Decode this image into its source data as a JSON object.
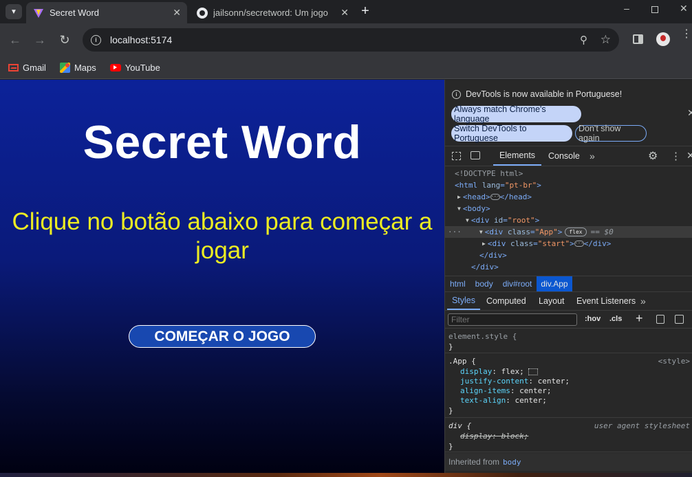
{
  "browser": {
    "tabs": [
      {
        "title": "Secret Word",
        "active": true
      },
      {
        "title": "jailsonn/secretword: Um jogo w",
        "active": false
      }
    ],
    "url": "localhost:5174",
    "bookmarks": [
      {
        "label": "Gmail",
        "icon": "gmail-icon"
      },
      {
        "label": "Maps",
        "icon": "maps-icon"
      },
      {
        "label": "YouTube",
        "icon": "youtube-icon"
      }
    ]
  },
  "app": {
    "title": "Secret Word",
    "subtitle": "Clique no botão abaixo para começar a jogar",
    "start_button": "COMEÇAR O JOGO",
    "bg_top": "#0c2299",
    "bg_bottom": "#000010",
    "subtitle_color": "#ecec22"
  },
  "devtools": {
    "notice": "DevTools is now available in Portuguese!",
    "chip_match": "Always match Chrome's language",
    "chip_switch": "Switch DevTools to Portuguese",
    "chip_dont": "Don't show again",
    "tabs": [
      "Elements",
      "Console"
    ],
    "dom": {
      "doctype": "<!DOCTYPE html>",
      "html_open": "<html",
      "html_attr": "lang",
      "html_val": "\"pt-br\"",
      "head": "<head>",
      "head_close": "</head>",
      "body": "<body>",
      "div_open": "<div",
      "id_attr": "id",
      "id_val": "\"root\"",
      "class_attr": "class",
      "app_val": "\"App\"",
      "flex_badge": "flex",
      "eq": "== $0",
      "start_val": "\"start\"",
      "div_close": "</div>",
      "lt": "<",
      "gt": ">"
    },
    "breadcrumbs": [
      "html",
      "body",
      "div#root",
      "div.App"
    ],
    "style_tabs": [
      "Styles",
      "Computed",
      "Layout",
      "Event Listeners"
    ],
    "filter_placeholder": "Filter",
    "hov": ":hov",
    "cls": ".cls",
    "rules": {
      "element_style": "element.style {",
      "close": "}",
      "app_selector": ".App {",
      "app_source": "<style>",
      "app_props": [
        {
          "name": "display",
          "value": "flex;"
        },
        {
          "name": "justify-content",
          "value": "center;"
        },
        {
          "name": "align-items",
          "value": "center;"
        },
        {
          "name": "text-align",
          "value": "center;"
        }
      ],
      "div_selector": "div {",
      "div_source": "user agent stylesheet",
      "div_prop": "display: block;",
      "inherited_label": "Inherited from",
      "inherited_from": "body"
    }
  }
}
